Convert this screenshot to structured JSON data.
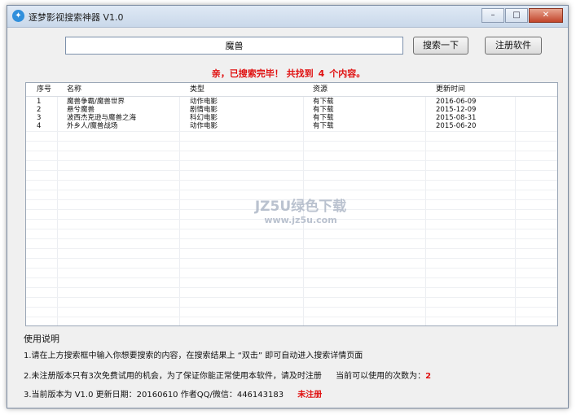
{
  "window": {
    "title": "逐梦影视搜索神器 V1.0"
  },
  "titlebar_buttons": {
    "minimize": "–",
    "maximize": "□",
    "close": "✕"
  },
  "search": {
    "value": "魔兽"
  },
  "buttons": {
    "search": "搜索一下",
    "register": "注册软件"
  },
  "status": {
    "prefix": "亲，已搜索完毕！ 共找到",
    "count": "4",
    "suffix": "个内容。"
  },
  "table": {
    "headers": [
      "序号",
      "名称",
      "类型",
      "资源",
      "更新时间"
    ],
    "rows": [
      [
        "1",
        "魔兽争霸/魔兽世界",
        "动作电影",
        "有下载",
        "2016-06-09"
      ],
      [
        "2",
        "悬兮魔兽",
        "剧情电影",
        "有下载",
        "2015-12-09"
      ],
      [
        "3",
        "波西杰克逊与魔兽之海",
        "科幻电影",
        "有下载",
        "2015-08-31"
      ],
      [
        "4",
        "外乡人/魔兽战场",
        "动作电影",
        "有下载",
        "2015-06-20"
      ]
    ]
  },
  "usage": {
    "heading": "使用说明",
    "line1": "1.请在上方搜索框中输入你想要搜索的内容，在搜索结果上 “双击” 即可自动进入搜索详情页面",
    "line2": "2.未注册版本只有3次免费试用的机会，为了保证你能正常使用本软件，请及时注册",
    "remaining_label": "当前可以使用的次数为：",
    "remaining_value": "2",
    "line3": "3.当前版本为 V1.0 更新日期：20160610 作者QQ/微信：446143183",
    "unregistered": "未注册"
  },
  "watermark": {
    "line1": "JZ5U绿色下载",
    "line2": "www.jz5u.com"
  },
  "colors": {
    "accent_red": "#e01010",
    "title_gradient_top": "#dfe9f5"
  }
}
